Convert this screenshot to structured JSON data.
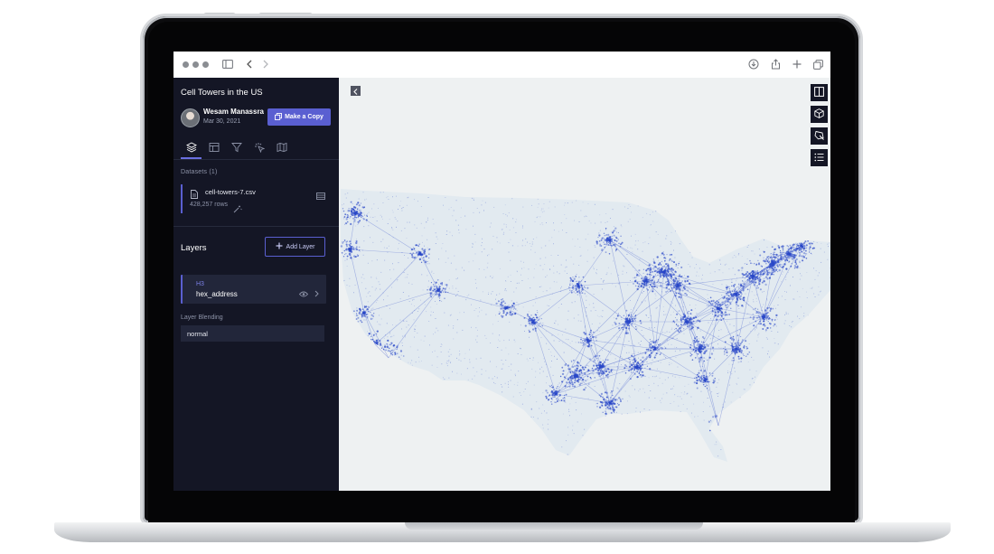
{
  "map_title": "Cell Towers in the US",
  "author": {
    "name": "Wesam Manassra",
    "date": "Mar 30, 2021"
  },
  "actions": {
    "make_copy_label": "Make a Copy"
  },
  "tabs": [
    {
      "icon": "layers-icon",
      "active": true
    },
    {
      "icon": "table-icon",
      "active": false
    },
    {
      "icon": "filter-icon",
      "active": false
    },
    {
      "icon": "interaction-icon",
      "active": false
    },
    {
      "icon": "basemap-icon",
      "active": false
    }
  ],
  "datasets": {
    "header": "Datasets (1)",
    "items": [
      {
        "name": "cell-towers-7.csv",
        "rows": "428,257 rows"
      }
    ]
  },
  "layers": {
    "title": "Layers",
    "add_label": "Add Layer",
    "items": [
      {
        "type": "H3",
        "name": "hex_address"
      }
    ]
  },
  "blending": {
    "label": "Layer Blending",
    "value": "normal"
  },
  "map_controls": [
    "split-map-icon",
    "3d-view-icon",
    "draw-icon",
    "legend-icon"
  ],
  "colors": {
    "panel_bg": "#141625",
    "accent": "#5a5fd1",
    "map_bg": "#eef1f2",
    "density": "#2a48c8"
  }
}
